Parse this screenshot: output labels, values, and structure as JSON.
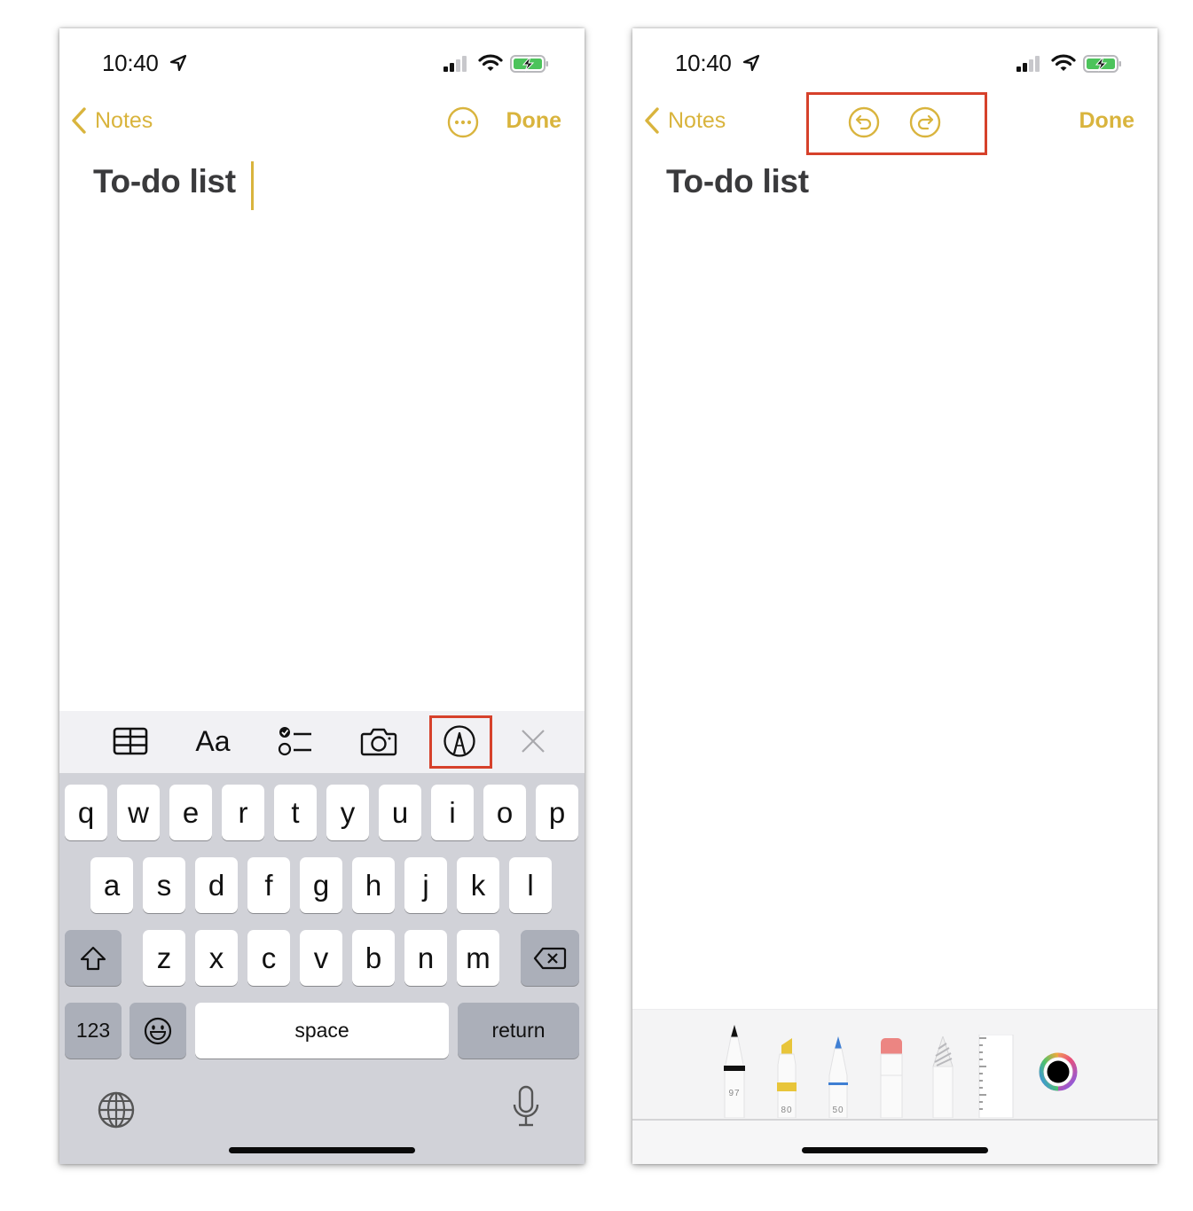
{
  "colors": {
    "accent": "#d9b43d",
    "highlight_box": "#d6412b",
    "keyboard_bg": "#d1d2d8",
    "title_text": "#3a3a3c"
  },
  "left_screen": {
    "status_bar": {
      "time": "10:40",
      "icons": [
        "location-arrow-icon",
        "cellular-signal-icon",
        "wifi-icon",
        "battery-charging-icon"
      ]
    },
    "nav": {
      "back_label": "Notes",
      "more_icon": "ellipsis-circle-icon",
      "done_label": "Done"
    },
    "note": {
      "title": "To-do list",
      "cursor_visible": true
    },
    "format_toolbar": {
      "items": [
        {
          "name": "table",
          "icon": "table-icon"
        },
        {
          "name": "format",
          "label": "Aa"
        },
        {
          "name": "checklist",
          "icon": "checklist-icon"
        },
        {
          "name": "camera",
          "icon": "camera-icon"
        },
        {
          "name": "markup",
          "icon": "markup-pen-icon",
          "highlighted": true
        },
        {
          "name": "close",
          "icon": "close-icon"
        }
      ]
    },
    "keyboard": {
      "row1": [
        "q",
        "w",
        "e",
        "r",
        "t",
        "y",
        "u",
        "i",
        "o",
        "p"
      ],
      "row2": [
        "a",
        "s",
        "d",
        "f",
        "g",
        "h",
        "j",
        "k",
        "l"
      ],
      "row3": [
        "z",
        "x",
        "c",
        "v",
        "b",
        "n",
        "m"
      ],
      "shift_icon": "shift-icon",
      "delete_icon": "backspace-icon",
      "numbers_label": "123",
      "emoji_icon": "emoji-icon",
      "space_label": "space",
      "return_label": "return",
      "globe_icon": "globe-icon",
      "mic_icon": "microphone-icon"
    }
  },
  "right_screen": {
    "status_bar": {
      "time": "10:40",
      "icons": [
        "location-arrow-icon",
        "cellular-signal-icon",
        "wifi-icon",
        "battery-charging-icon"
      ]
    },
    "nav": {
      "back_label": "Notes",
      "undo_icon": "undo-icon",
      "redo_icon": "redo-icon",
      "done_label": "Done",
      "undo_redo_highlighted": true
    },
    "note": {
      "title": "To-do list"
    },
    "drawing_tools": [
      {
        "name": "pen",
        "label": "97",
        "color": "#111111"
      },
      {
        "name": "marker",
        "label": "80",
        "color": "#e8c53a"
      },
      {
        "name": "pencil",
        "label": "50",
        "color": "#3f7fd3"
      },
      {
        "name": "eraser",
        "label": "",
        "color": "#ec8582"
      },
      {
        "name": "lasso",
        "label": "",
        "color": "#c8c8c8"
      },
      {
        "name": "ruler",
        "label": "",
        "color": "#ffffff"
      }
    ],
    "selected_color": "#000000"
  }
}
